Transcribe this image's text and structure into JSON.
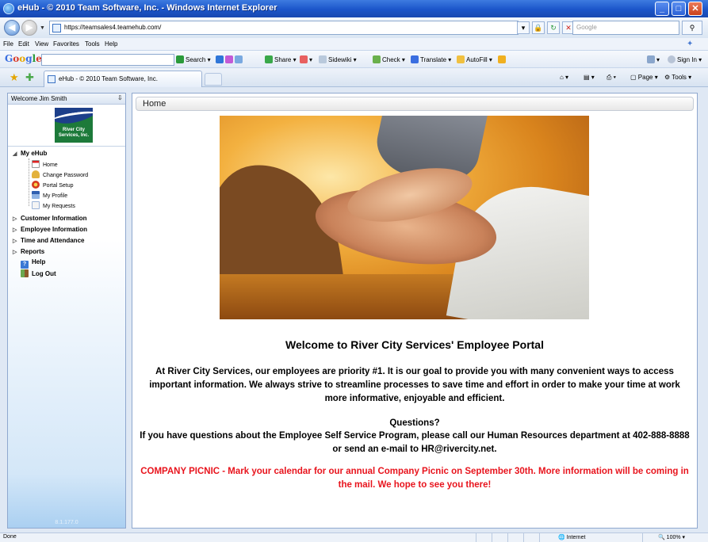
{
  "window": {
    "title": "eHub - © 2010 Team Software, Inc. - Windows Internet Explorer"
  },
  "address": {
    "url": "https://teamsales4.teamehub.com/",
    "search_placeholder": "Google"
  },
  "menu": [
    "File",
    "Edit",
    "View",
    "Favorites",
    "Tools",
    "Help"
  ],
  "google_toolbar": {
    "logo": "Google",
    "items": [
      "Search",
      "Share",
      "Sidewiki",
      "Check",
      "Translate",
      "AutoFill"
    ],
    "signin": "Sign In"
  },
  "tab": {
    "title": "eHub - © 2010 Team Software, Inc."
  },
  "commands": {
    "page": "Page",
    "tools": "Tools"
  },
  "sidebar": {
    "welcome": "Welcome Jim Smith",
    "logo_text": "River City Services, Inc.",
    "groups": {
      "my_ehub": "My eHub",
      "home": "Home",
      "change_password": "Change Password",
      "portal_setup": "Portal Setup",
      "my_profile": "My Profile",
      "my_requests": "My Requests",
      "customer_information": "Customer Information",
      "employee_information": "Employee Information",
      "time_and_attendance": "Time and Attendance",
      "reports": "Reports",
      "help": "Help",
      "log_out": "Log Out"
    },
    "version": "8.1.177.0"
  },
  "main": {
    "header": "Home",
    "welcome_title": "Welcome to River City Services' Employee Portal",
    "paragraph1": "At River City Services, our employees are priority #1.  It is our goal to provide you with many convenient ways to access important information.  We always strive to streamline processes to save time and effort in order to make your time at work more informative, enjoyable and efficient.",
    "questions_heading": "Questions?",
    "paragraph2": "If you have questions about the Employee Self Service Program, please call our Human Resources department at 402-888-8888 or send an e-mail to HR@rivercity.net.",
    "picnic": "COMPANY PICNIC - Mark your calendar for our annual Company Picnic on September 30th.  More information will be coming in the mail.  We hope to see you there!"
  },
  "status": {
    "left": "Done",
    "zone": "Internet",
    "zoom": "100%"
  }
}
